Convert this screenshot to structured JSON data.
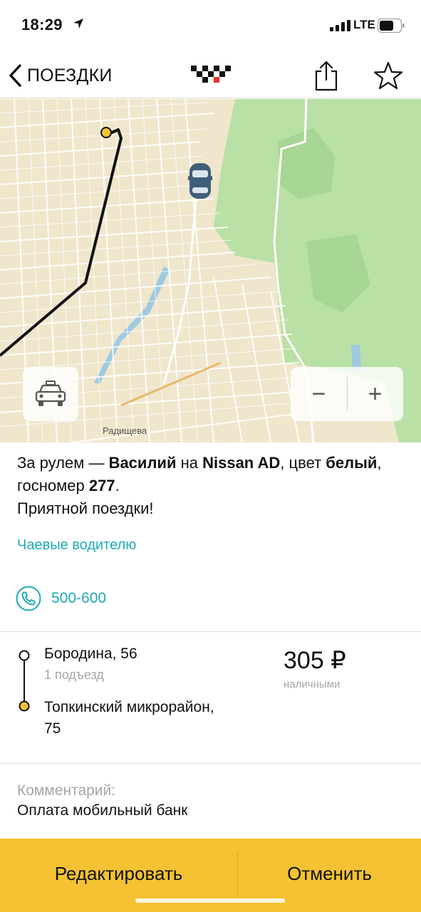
{
  "status_bar": {
    "time": "18:29",
    "network": "LTE",
    "icons": [
      "location-arrow-icon",
      "signal-bars-icon",
      "battery-icon"
    ]
  },
  "nav": {
    "back_label": "ПОЕЗДКИ",
    "icons": [
      "chevron-left-icon",
      "taxi-logo-icon",
      "share-icon",
      "star-icon"
    ]
  },
  "map": {
    "street_label": "Радищева",
    "zoom_out_label": "−",
    "zoom_in_label": "+",
    "icons": [
      "taxi-car-icon",
      "driver-car-icon",
      "pickup-point-icon"
    ],
    "colors": {
      "land": "#efe6cc",
      "forest": "#b9e0a5",
      "route": "#111111",
      "pickup": "#f4c232"
    }
  },
  "driver": {
    "prefix": "За рулем — ",
    "name": "Василий",
    "on": " на ",
    "car": "Nissan AD",
    "color_prefix": ", цвет ",
    "color": "белый",
    "plate_prefix": ", госномер ",
    "plate": "277",
    "plate_suffix": ".",
    "greeting": "Приятной поездки!"
  },
  "tips_link": "Чаевые водителю",
  "phone": {
    "number": "500-600",
    "icon": "phone-icon"
  },
  "route": {
    "from": "Бородина, 56",
    "from_sub": "1 подъезд",
    "to": "Топкинский микрорайон, 75"
  },
  "price": {
    "amount": "305 ₽",
    "method": "наличными"
  },
  "comment": {
    "label": "Комментарий:",
    "text": "Оплата мобильный банк"
  },
  "actions": {
    "edit": "Редактировать",
    "cancel": "Отменить"
  },
  "colors": {
    "accent": "#f4c232",
    "link": "#1fa9b5",
    "muted": "#a6a6a6"
  }
}
